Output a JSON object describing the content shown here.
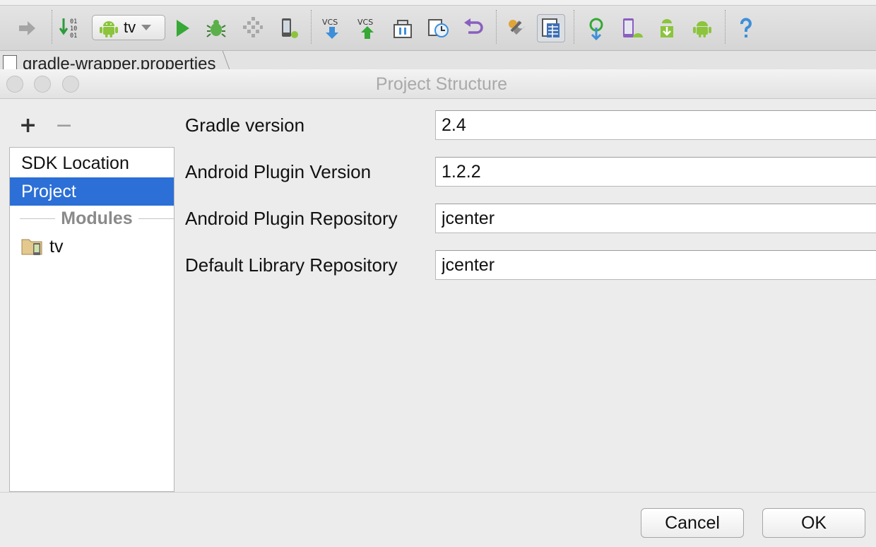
{
  "toolbar": {
    "run_config_label": "tv",
    "vcs_update_label": "VCS",
    "vcs_commit_label": "VCS",
    "binary_digits": [
      "01",
      "10",
      "01"
    ]
  },
  "editor": {
    "open_tab": "gradle-wrapper.properties"
  },
  "dialog": {
    "title": "Project Structure",
    "add_symbol": "+",
    "remove_symbol": "−",
    "side_list": {
      "items": [
        {
          "label": "SDK Location",
          "selected": false
        },
        {
          "label": "Project",
          "selected": true
        }
      ],
      "modules_header": "Modules",
      "modules": [
        {
          "label": "tv"
        }
      ]
    },
    "fields": [
      {
        "label": "Gradle version",
        "value": "2.4"
      },
      {
        "label": "Android Plugin Version",
        "value": "1.2.2"
      },
      {
        "label": "Android Plugin Repository",
        "value": "jcenter"
      },
      {
        "label": "Default Library Repository",
        "value": "jcenter"
      }
    ],
    "buttons": {
      "cancel": "Cancel",
      "ok": "OK"
    }
  },
  "colors": {
    "selection": "#2c6fd6",
    "android_green": "#8cc43c",
    "run_green": "#35a835",
    "vcs_blue": "#3d8fd9",
    "help_blue": "#3d8fd9"
  }
}
